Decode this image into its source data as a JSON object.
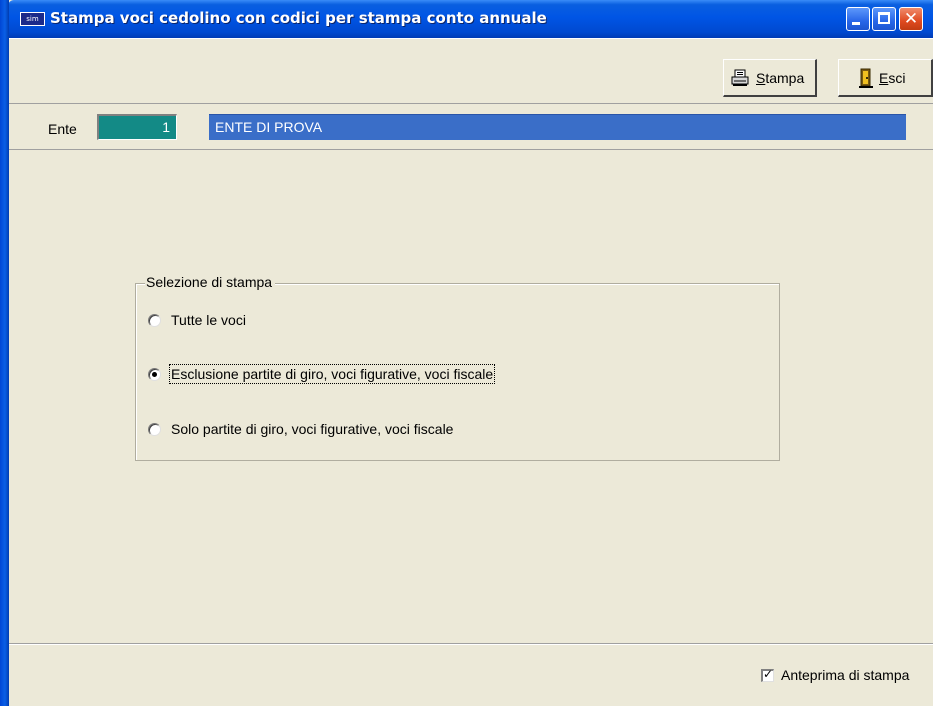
{
  "window": {
    "title": "Stampa voci cedolino con codici per stampa conto annuale",
    "app_icon_text": "sim",
    "close_glyph": "✕"
  },
  "toolbar": {
    "stampa_label_underlined": "S",
    "stampa_label_rest": "tampa",
    "esci_label_underlined": "E",
    "esci_label_rest": "sci"
  },
  "ente": {
    "label": "Ente",
    "code": "1",
    "name": "ENTE DI PROVA"
  },
  "selection": {
    "legend": "Selezione di stampa",
    "options": [
      {
        "label": "Tutte le voci",
        "selected": false
      },
      {
        "label": "Esclusione partite di giro, voci figurative, voci fiscale",
        "selected": true
      },
      {
        "label": "Solo partite di giro, voci figurative, voci fiscale",
        "selected": false
      }
    ]
  },
  "footer": {
    "preview_label": "Anteprima di stampa",
    "preview_checked": true,
    "check_glyph": "✓"
  },
  "colors": {
    "titlebar": "#0055e5",
    "ente_code_bg": "#138a86",
    "ente_name_bg": "#3a6ec8",
    "window_bg": "#ece9d8"
  }
}
